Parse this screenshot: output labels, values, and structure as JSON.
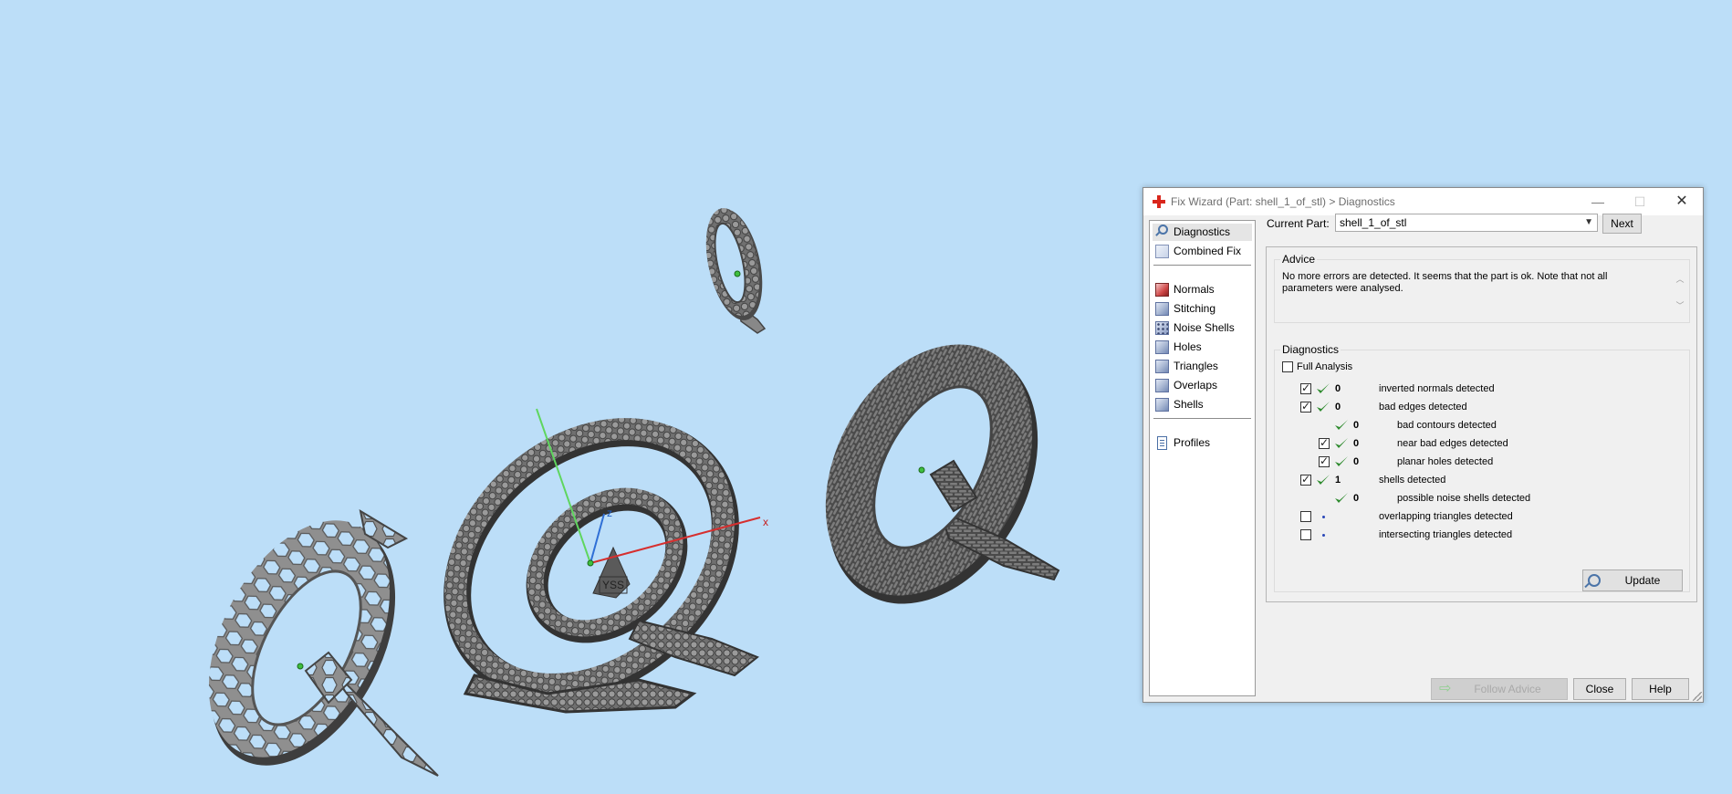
{
  "viewport": {
    "axis_labels": {
      "x": "x",
      "z": "z"
    },
    "tag_label": "YSS"
  },
  "dialog": {
    "title": "Fix Wizard (Part: shell_1_of_stl) > Diagnostics",
    "window_controls": {
      "minimize": "—",
      "maximize": "☐",
      "close": "✕"
    },
    "sidebar": {
      "items": [
        {
          "label": "Diagnostics",
          "icon": "magnifier-icon"
        },
        {
          "label": "Combined Fix",
          "icon": "cube-icon"
        },
        {
          "label": "Normals",
          "icon": "normals-cube-icon"
        },
        {
          "label": "Stitching",
          "icon": "stitching-cube-icon"
        },
        {
          "label": "Noise Shells",
          "icon": "noise-shells-icon"
        },
        {
          "label": "Holes",
          "icon": "holes-cube-icon"
        },
        {
          "label": "Triangles",
          "icon": "triangles-cube-icon"
        },
        {
          "label": "Overlaps",
          "icon": "overlaps-cube-icon"
        },
        {
          "label": "Shells",
          "icon": "shells-cube-icon"
        },
        {
          "label": "Profiles",
          "icon": "document-icon"
        }
      ]
    },
    "current_part_label": "Current Part:",
    "current_part_value": "shell_1_of_stl",
    "next_label": "Next",
    "advice": {
      "heading": "Advice",
      "text": "No more errors are detected. It seems that the part is ok. Note that not all parameters were analysed."
    },
    "diagnostics": {
      "heading": "Diagnostics",
      "full_analysis_label": "Full Analysis",
      "full_analysis_checked": false,
      "rows": [
        {
          "count": "0",
          "label": "inverted normals detected",
          "checkbox": "checked",
          "status": "ok",
          "indent": 0
        },
        {
          "count": "0",
          "label": "bad edges detected",
          "checkbox": "checked",
          "status": "ok",
          "indent": 0
        },
        {
          "count": "0",
          "label": "bad contours detected",
          "checkbox": "none",
          "status": "ok",
          "indent": 1
        },
        {
          "count": "0",
          "label": "near bad edges detected",
          "checkbox": "checked",
          "status": "ok",
          "indent": 1
        },
        {
          "count": "0",
          "label": "planar holes detected",
          "checkbox": "checked",
          "status": "ok",
          "indent": 1
        },
        {
          "count": "1",
          "label": "shells detected",
          "checkbox": "checked",
          "status": "ok",
          "indent": 0
        },
        {
          "count": "0",
          "label": "possible noise shells detected",
          "checkbox": "none",
          "status": "ok",
          "indent": 1
        },
        {
          "count": "",
          "label": "overlapping triangles detected",
          "checkbox": "unchecked",
          "status": "not-analysed",
          "indent": 0
        },
        {
          "count": "",
          "label": "intersecting triangles detected",
          "checkbox": "unchecked",
          "status": "not-analysed",
          "indent": 0
        }
      ],
      "update_label": "Update"
    },
    "follow_advice_label": "Follow Advice",
    "close_label": "Close",
    "help_label": "Help",
    "colors": {
      "ok_check": "#2e8b2e",
      "background": "#bcdef8",
      "title_icon": "#d9261c"
    }
  }
}
